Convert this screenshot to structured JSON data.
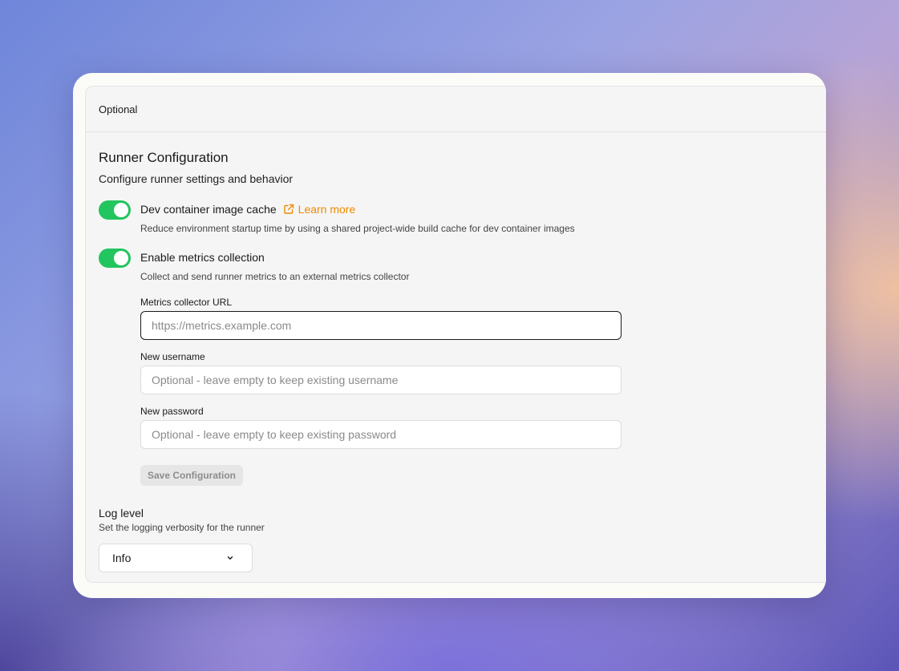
{
  "panel": {
    "header_label": "Optional"
  },
  "runner": {
    "title": "Runner Configuration",
    "description": "Configure runner settings and behavior"
  },
  "settings": {
    "dev_cache": {
      "label": "Dev container image cache",
      "enabled": true,
      "learn_more_label": "Learn more",
      "help": "Reduce environment startup time by using a shared project-wide build cache for dev container images"
    },
    "metrics": {
      "label": "Enable metrics collection",
      "enabled": true,
      "help": "Collect and send runner metrics to an external metrics collector",
      "url_label": "Metrics collector URL",
      "url_placeholder": "https://metrics.example.com",
      "url_value": "",
      "username_label": "New username",
      "username_placeholder": "Optional - leave empty to keep existing username",
      "username_value": "",
      "password_label": "New password",
      "password_placeholder": "Optional - leave empty to keep existing password",
      "password_value": "",
      "save_label": "Save Configuration"
    }
  },
  "log_level": {
    "title": "Log level",
    "description": "Set the logging verbosity for the runner",
    "selected": "Info"
  },
  "colors": {
    "toggle_on": "#22c55e",
    "link": "#ef8a00",
    "panel_bg": "#f5f5f5"
  },
  "icons": {
    "learn_more": "external-link-icon",
    "select": "chevron-down-icon"
  }
}
